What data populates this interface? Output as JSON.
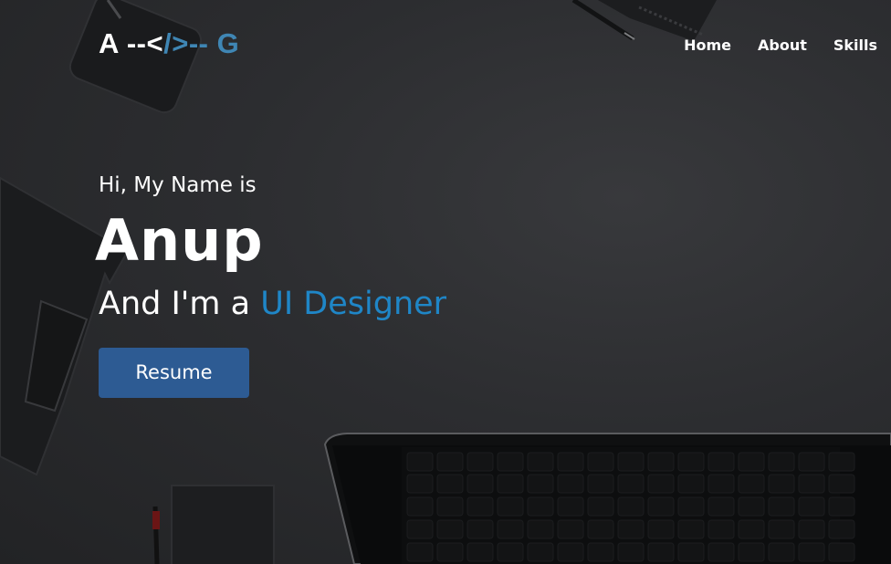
{
  "nav": {
    "logo": {
      "part1": "A --<",
      "part2": "/>--",
      "part3": " G"
    },
    "links": [
      {
        "label": "Home"
      },
      {
        "label": "About"
      },
      {
        "label": "Skills"
      }
    ]
  },
  "hero": {
    "greeting": "Hi, My Name is",
    "name": "Anup",
    "role_prefix": "And I'm a ",
    "role_highlight": "UI Designer",
    "button_label": "Resume"
  },
  "colors": {
    "background": "#2a2b2d",
    "accent": "#1f86c7",
    "logo_accent": "#3f86b4",
    "button": "#2d5b93",
    "text": "#ffffff"
  }
}
